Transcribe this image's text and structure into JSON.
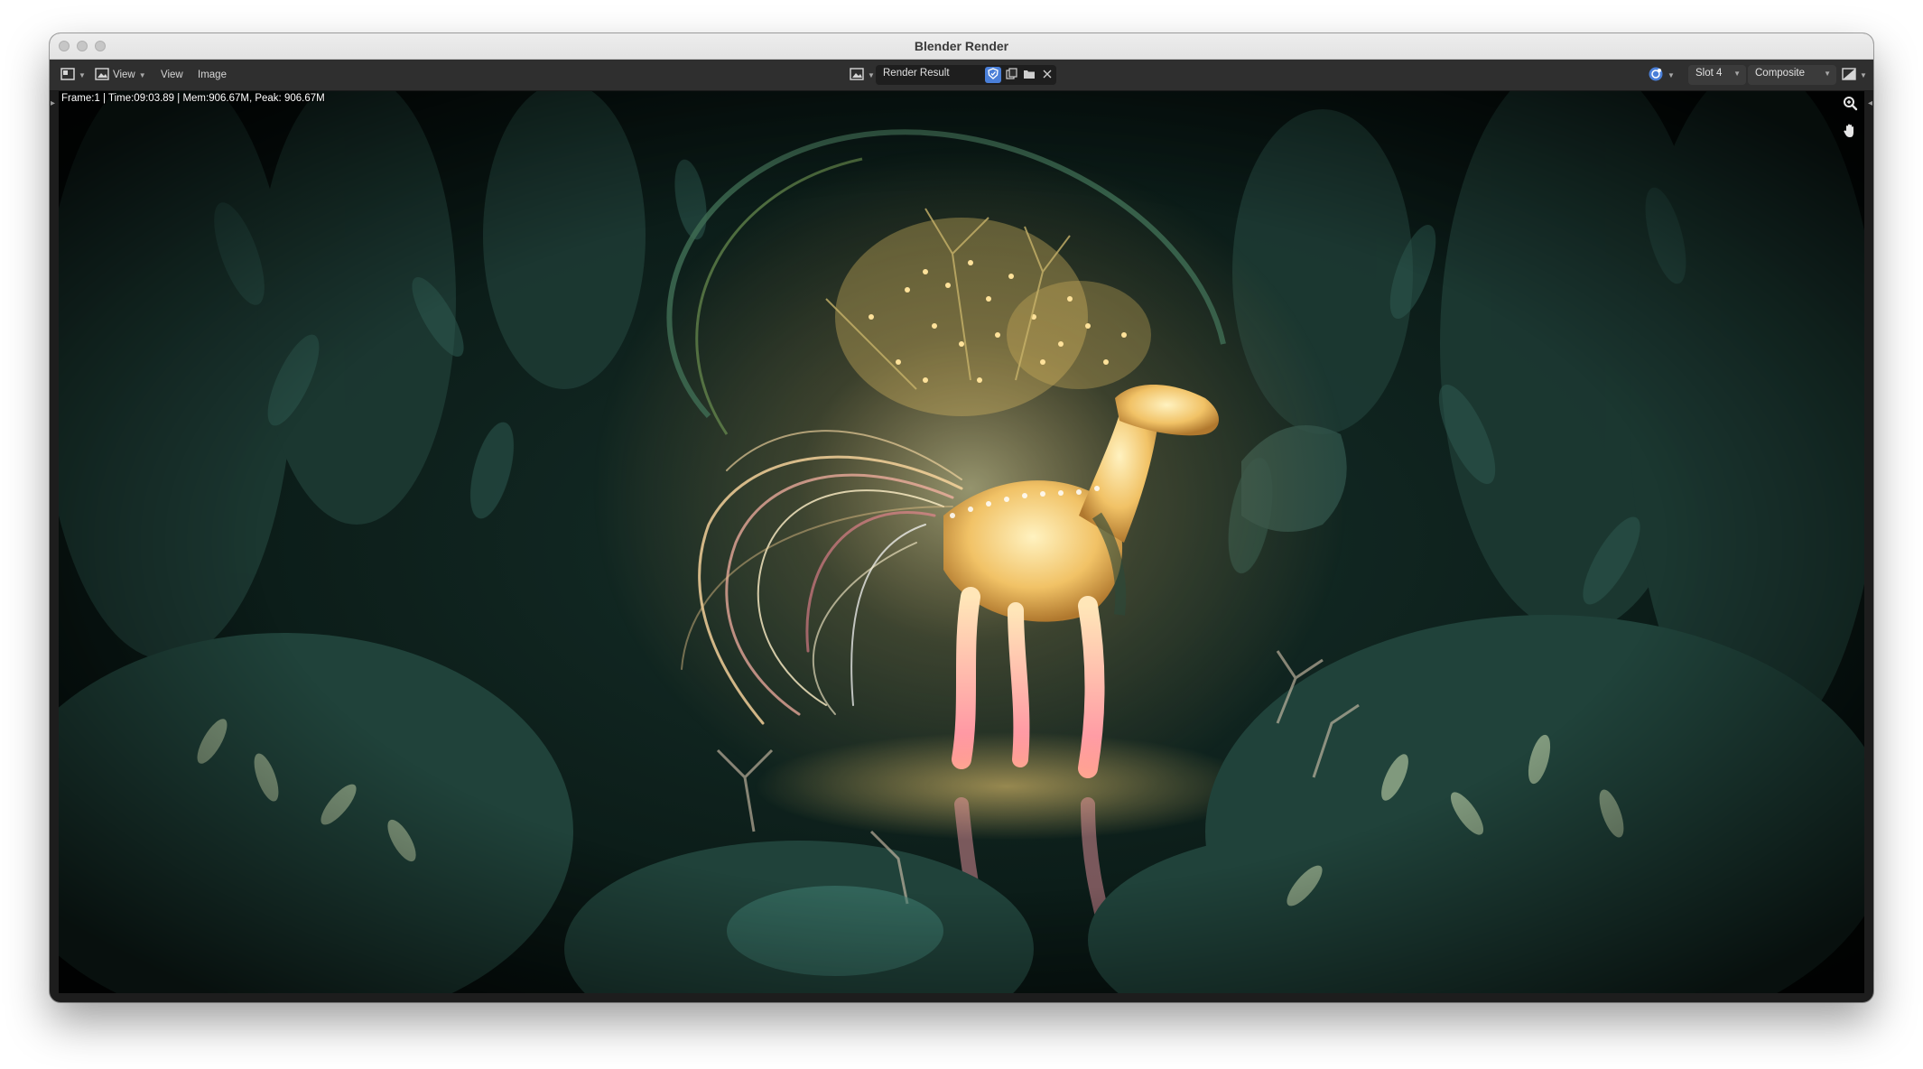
{
  "window": {
    "title": "Blender Render"
  },
  "header": {
    "editor_type_icon": "image-editor-icon",
    "view_menu_label": "View",
    "view_label": "View",
    "image_label": "Image",
    "image_browse_icon": "image-browse-icon",
    "image_name": "Render Result",
    "fake_user_icon": "shield-icon",
    "duplicate_icon": "duplicate-icon",
    "open_icon": "folder-icon",
    "unlink_icon": "close-icon",
    "gizmo_icon": "gizmo-icon",
    "slot_label": "Slot 4",
    "pass_label": "Composite",
    "display_mode_icon": "display-channels-icon"
  },
  "render": {
    "stats": "Frame:1 | Time:09:03.89 | Mem:906.67M, Peak: 906.67M",
    "subject": "glowing-deer-creature-in-jungle"
  },
  "navigation": {
    "zoom_icon": "zoom-icon",
    "pan_icon": "hand-pan-icon"
  },
  "colors": {
    "header_bg": "#2f2f2f",
    "accent_blue": "#4a7fd8",
    "render_glow": "#ffd777"
  }
}
